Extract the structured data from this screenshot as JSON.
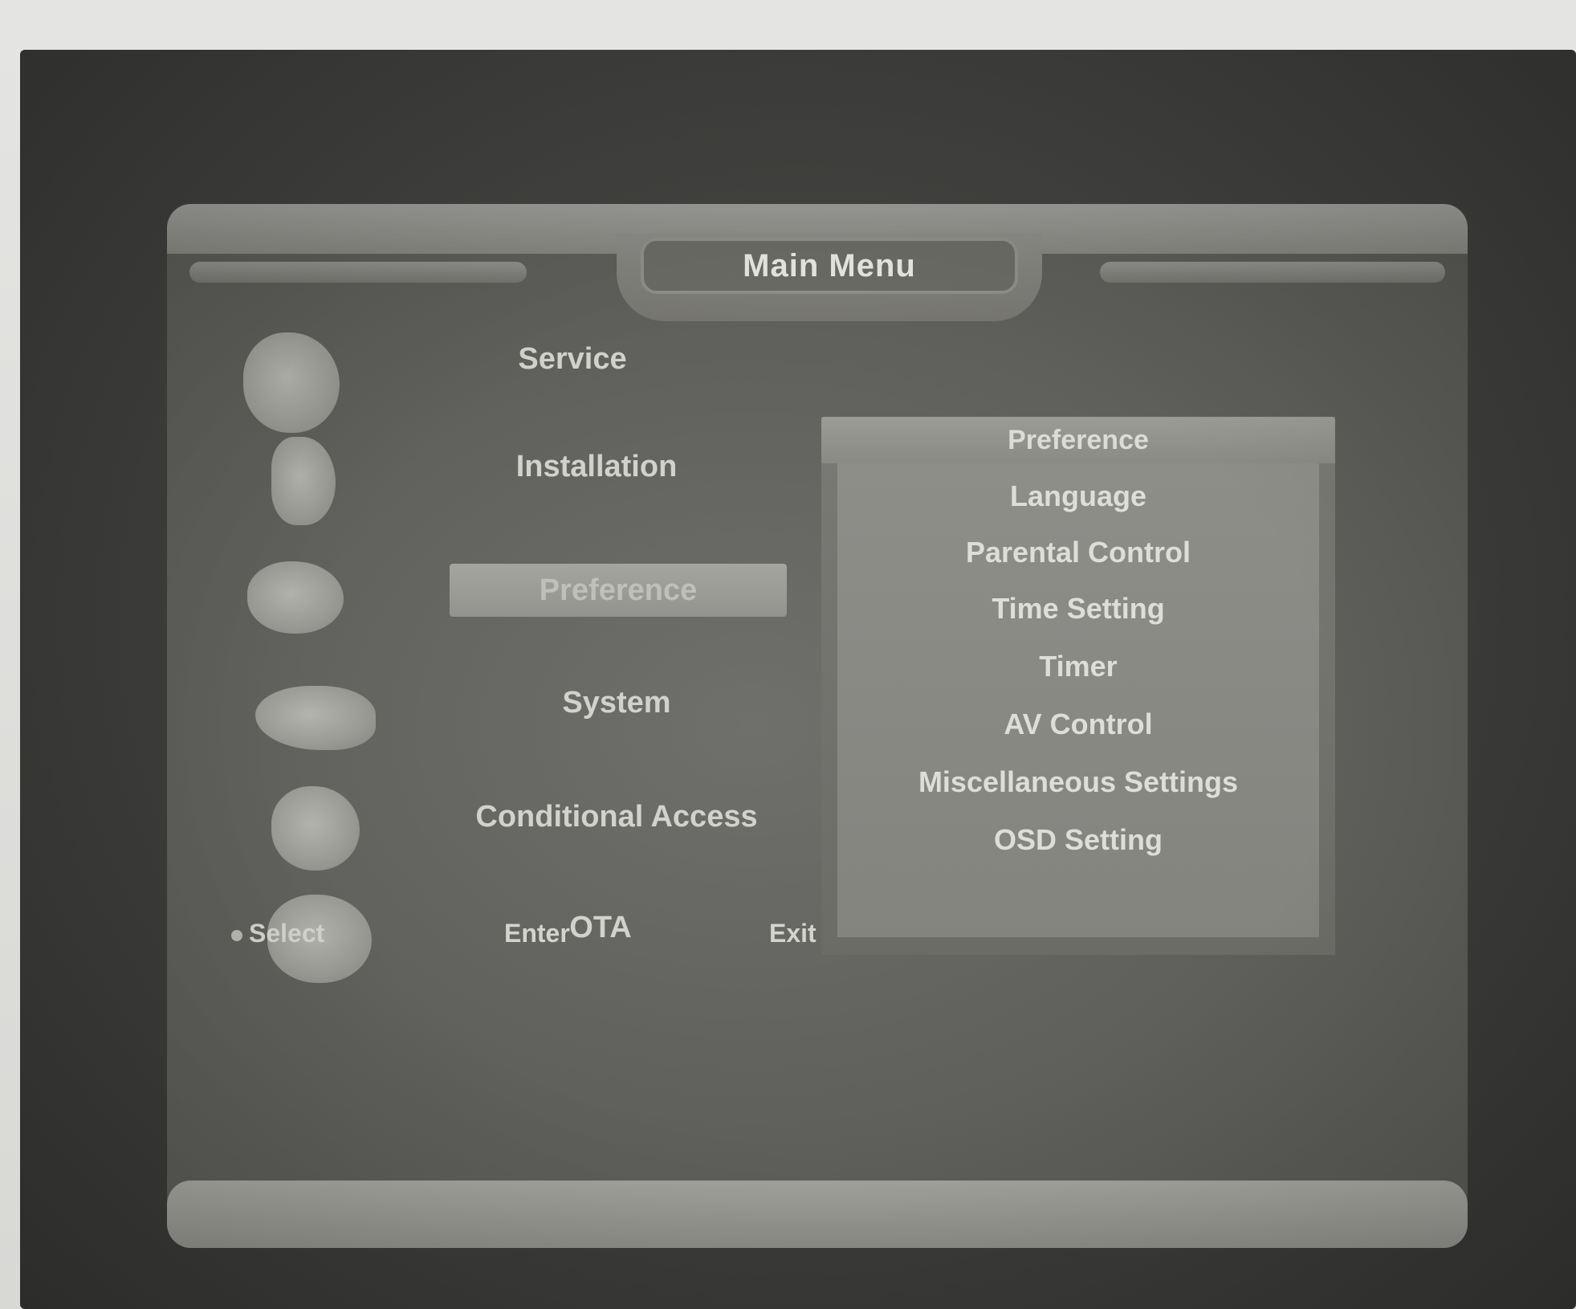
{
  "osd": {
    "title": "Main Menu"
  },
  "menu": {
    "items": [
      {
        "label": "Service",
        "icon": "tv-icon"
      },
      {
        "label": "Installation",
        "icon": "dish-icon"
      },
      {
        "label": "Preference",
        "icon": "preference-icon"
      },
      {
        "label": "System",
        "icon": "system-icon"
      },
      {
        "label": "Conditional Access",
        "icon": "access-icon"
      },
      {
        "label": "OTA",
        "icon": "ota-icon"
      }
    ],
    "selected_index": 2
  },
  "submenu": {
    "header": "Preference",
    "items": [
      {
        "label": "Language"
      },
      {
        "label": "Parental Control"
      },
      {
        "label": "Time Setting"
      },
      {
        "label": "Timer"
      },
      {
        "label": "AV Control"
      },
      {
        "label": "Miscellaneous Settings"
      },
      {
        "label": "OSD Setting"
      }
    ]
  },
  "hints": {
    "select": "Select",
    "enter": "Enter",
    "exit": "Exit"
  },
  "colors": {
    "bezel": "#3a3a38",
    "screen": "#636360",
    "highlight": "#a0a09b",
    "text": "#deded8"
  }
}
